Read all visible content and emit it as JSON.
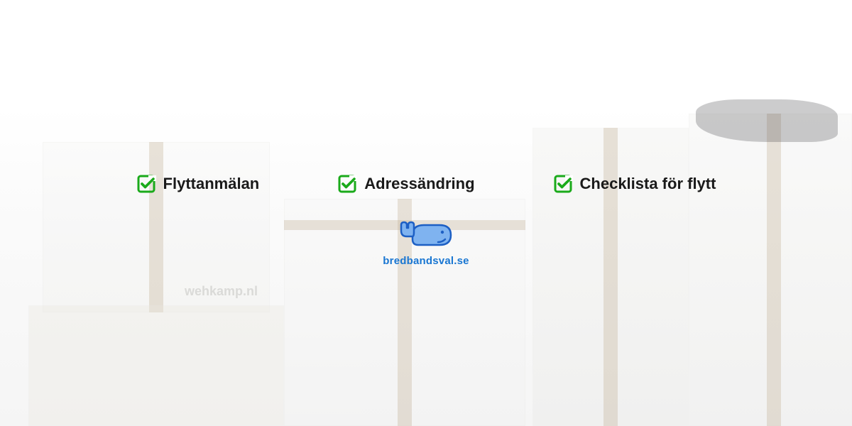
{
  "features": [
    {
      "label": "Flyttanmälan"
    },
    {
      "label": "Adressändring"
    },
    {
      "label": "Checklista för flytt"
    }
  ],
  "logo": {
    "text": "bredbandsval.se"
  },
  "background": {
    "box_label": "wehkamp.nl"
  },
  "colors": {
    "check": "#1aaa1a",
    "whale_fill": "#7fb3f0",
    "whale_stroke": "#1d5fc4",
    "logo_text": "#1976d2"
  }
}
